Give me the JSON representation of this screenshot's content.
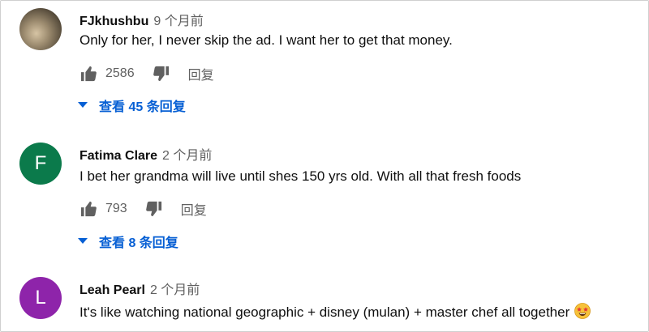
{
  "comments": [
    {
      "author": "FJkhushbu",
      "time": "9 个月前",
      "text": "Only for her, I never skip the ad. I want her to get that money.",
      "likes": "2586",
      "reply_label": "回复",
      "view_replies": "查看 45 条回复",
      "avatar": {
        "type": "photo"
      }
    },
    {
      "author": "Fatima Clare",
      "time": "2 个月前",
      "text": "I bet her grandma will live until shes 150 yrs old. With all that fresh foods",
      "likes": "793",
      "reply_label": "回复",
      "view_replies": "查看 8 条回复",
      "avatar": {
        "type": "initial",
        "letter": "F",
        "color": "#0b7a4b"
      }
    },
    {
      "author": "Leah Pearl",
      "time": "2 个月前",
      "text": "It's like watching national geographic + disney (mulan) + master chef all together",
      "emoji": "star-struck-emoji",
      "avatar": {
        "type": "initial",
        "letter": "L",
        "color": "#8e24aa"
      }
    }
  ],
  "colors": {
    "link": "#065fd4",
    "secondary": "#606060",
    "text": "#0f0f0f"
  },
  "icons": {
    "like": "thumbs-up-icon",
    "dislike": "thumbs-down-icon",
    "expand": "chevron-down-icon"
  }
}
